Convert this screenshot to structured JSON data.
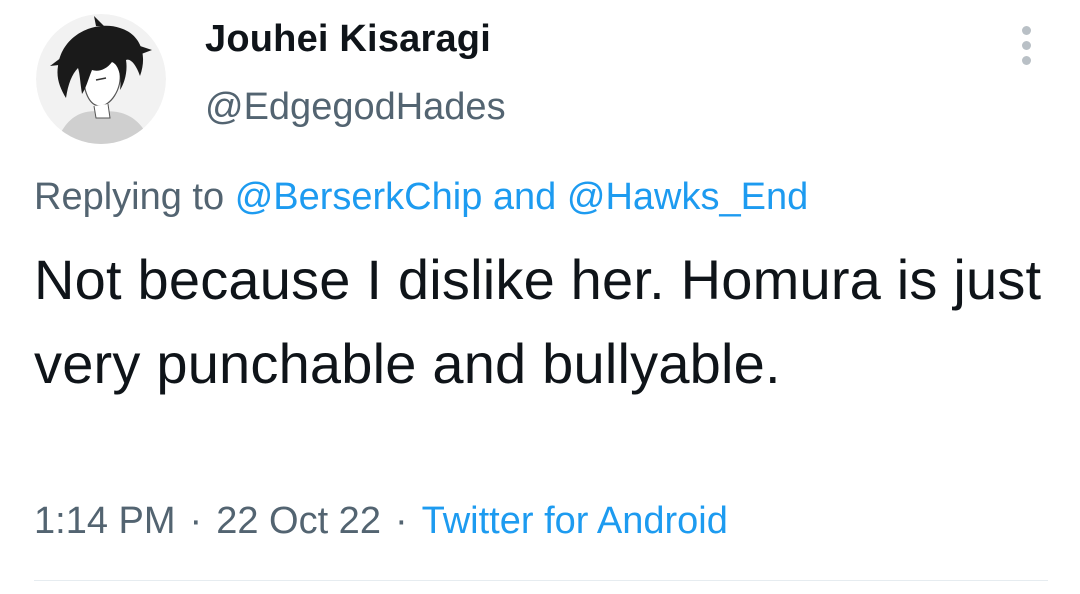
{
  "author": {
    "display_name": "Jouhei Kisaragi",
    "handle": "@EdgegodHades"
  },
  "reply": {
    "prefix": "Replying to",
    "mention_1": "@BerserkChip",
    "joiner": "and",
    "mention_2": "@Hawks_End"
  },
  "tweet": {
    "text": "Not because I dislike her. Homura is just very punchable and bullyable."
  },
  "meta": {
    "time": "1:14 PM",
    "separator": "·",
    "date": "22 Oct 22",
    "source": "Twitter for Android"
  },
  "icons": {
    "avatar": "avatar-manga-boy",
    "more": "more-vertical-icon"
  },
  "colors": {
    "text": "#0f1419",
    "secondary": "#536471",
    "link": "#1d9bf0",
    "divider": "#e6ecf0"
  }
}
